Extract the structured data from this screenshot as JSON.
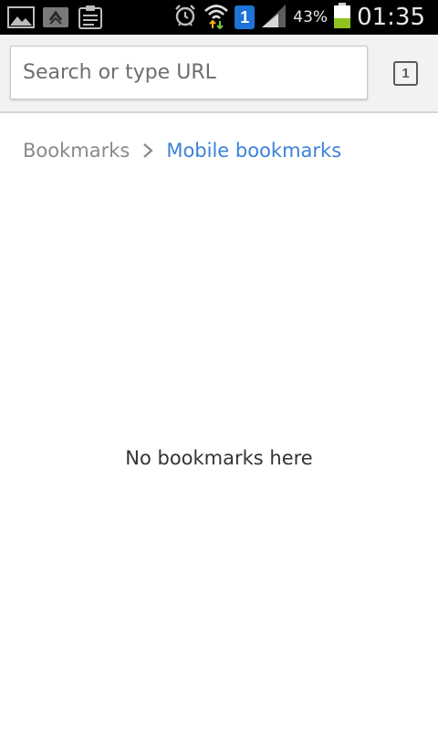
{
  "status_bar": {
    "icons_left": [
      "gallery-icon",
      "sync-icon",
      "clipboard-icon"
    ],
    "icons_right": [
      "alarm-icon",
      "wifi-icon",
      "notification-badge",
      "signal-icon",
      "battery-icon"
    ],
    "notification_count": "1",
    "battery_percent": "43%",
    "battery_level": 0.43,
    "time": "01:35"
  },
  "toolbar": {
    "search_placeholder": "Search or type URL",
    "tab_count": "1"
  },
  "breadcrumb": {
    "root": "Bookmarks",
    "current": "Mobile bookmarks"
  },
  "content": {
    "empty_message": "No bookmarks here"
  },
  "colors": {
    "status_bar_bg": "#000000",
    "toolbar_bg": "#f2f2f2",
    "link_blue": "#3b82d9",
    "battery_green": "#8fc31f",
    "badge_blue": "#1e73d6"
  }
}
